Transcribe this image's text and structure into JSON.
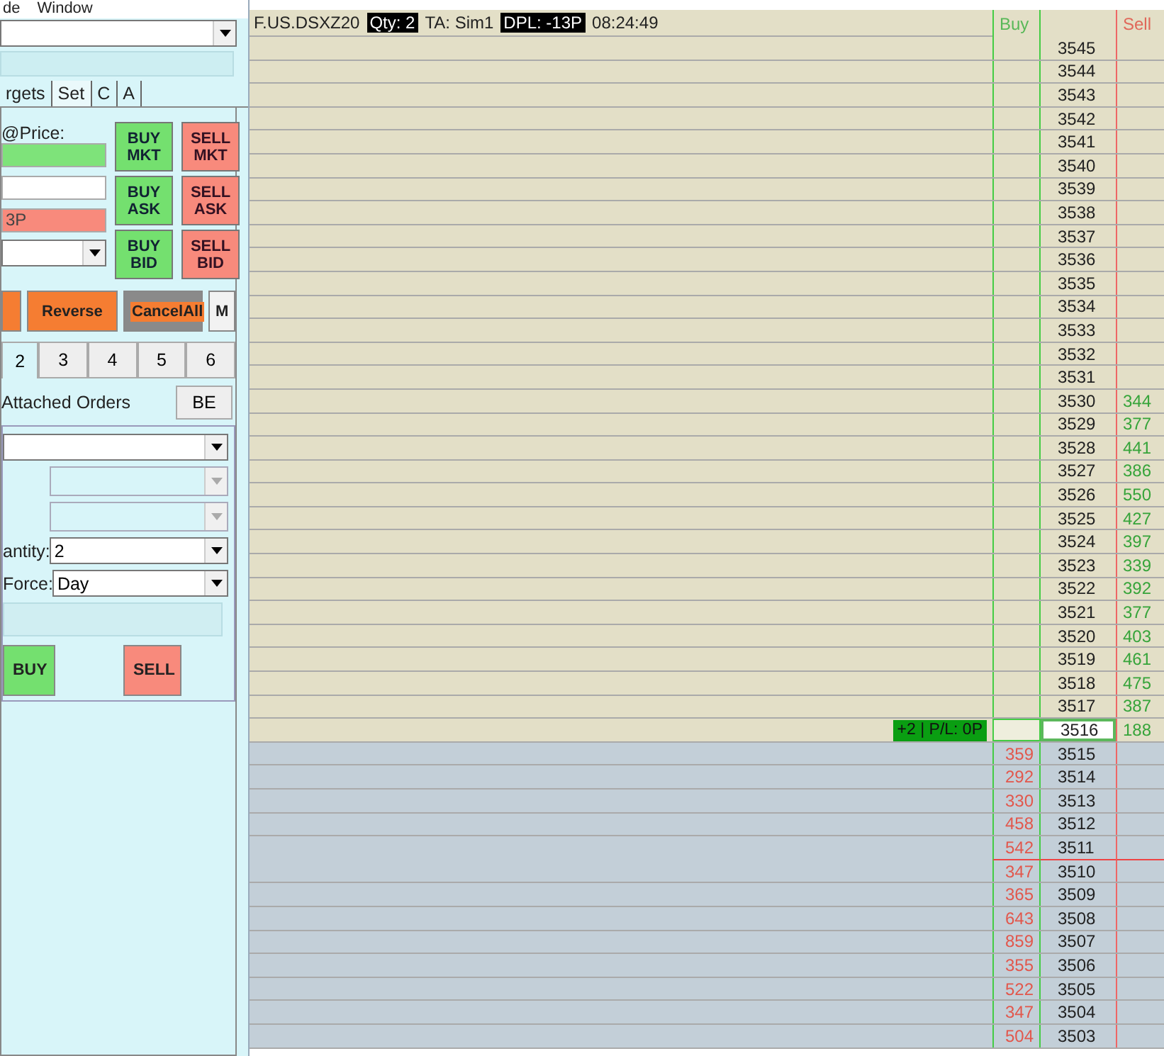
{
  "menu": [
    "de",
    "Window"
  ],
  "order_panel": {
    "tabs": [
      {
        "label": "rgets",
        "selected": false
      },
      {
        "label": "Set",
        "selected": true
      },
      {
        "label": "C",
        "selected": false
      },
      {
        "label": "A",
        "selected": false
      }
    ],
    "price_label": "@Price:",
    "red_field": {
      "value": "3P"
    },
    "order_buttons": [
      {
        "label": "BUY\nMKT",
        "kind": "buy"
      },
      {
        "label": "SELL\nMKT",
        "kind": "sell"
      },
      {
        "label": "BUY\nASK",
        "kind": "buy"
      },
      {
        "label": "SELL\nASK",
        "kind": "sell"
      },
      {
        "label": "BUY\nBID",
        "kind": "buy"
      },
      {
        "label": "SELL\nBID",
        "kind": "sell"
      }
    ],
    "action_buttons": [
      {
        "kind": "orange"
      },
      {
        "label": "Reverse",
        "kind": "orange"
      },
      {
        "label": "CancelAll",
        "kind": "cancel"
      },
      {
        "label": "M",
        "kind": "plain"
      }
    ],
    "number_tabs": [
      {
        "label": "2",
        "selected": true
      },
      {
        "label": "3",
        "selected": false
      },
      {
        "label": "4",
        "selected": false
      },
      {
        "label": "5",
        "selected": false
      },
      {
        "label": "6",
        "selected": false
      }
    ],
    "attached_orders_label": "Attached Orders",
    "be_button": "BE",
    "quantity_label": "antity:",
    "quantity": "2",
    "force_label": "Force:",
    "force": "Day",
    "buy_button": "BUY",
    "sell_button": "SELL"
  },
  "ladder": {
    "symbol": "F.US.DSXZ20",
    "qty": "Qty: 2",
    "account": "TA: Sim1",
    "dpl": "DPL: -13P",
    "time": "08:24:49",
    "buy_header": "Buy",
    "sell_header": "Sell",
    "ask_rows": [
      {
        "price": "3545",
        "selected": false,
        "marked": false
      },
      {
        "price": "3544",
        "selected": false,
        "marked": false
      },
      {
        "price": "3543",
        "selected": false,
        "marked": false
      },
      {
        "price": "3542",
        "selected": false,
        "marked": false
      },
      {
        "price": "3541",
        "selected": false,
        "marked": false
      },
      {
        "price": "3540",
        "selected": false,
        "marked": false
      },
      {
        "price": "3539",
        "selected": false,
        "marked": false
      },
      {
        "price": "3538",
        "selected": false,
        "marked": false
      },
      {
        "price": "3537",
        "selected": false,
        "marked": false
      },
      {
        "price": "3536",
        "selected": false,
        "marked": false
      },
      {
        "price": "3535",
        "selected": false,
        "marked": false
      },
      {
        "price": "3534",
        "selected": false,
        "marked": false
      },
      {
        "price": "3533",
        "selected": false,
        "marked": false
      },
      {
        "price": "3532",
        "selected": false,
        "marked": false
      },
      {
        "price": "3531",
        "selected": false,
        "marked": false
      },
      {
        "price": "3530",
        "sell": "344",
        "selected": false,
        "marked": false
      },
      {
        "price": "3529",
        "sell": "377",
        "selected": false,
        "marked": false
      },
      {
        "price": "3528",
        "sell": "441",
        "selected": false,
        "marked": false
      },
      {
        "price": "3527",
        "sell": "386",
        "selected": false,
        "marked": false
      },
      {
        "price": "3526",
        "sell": "550",
        "selected": false,
        "marked": false
      },
      {
        "price": "3525",
        "sell": "427",
        "selected": false,
        "marked": false
      },
      {
        "price": "3524",
        "sell": "397",
        "selected": false,
        "marked": false
      },
      {
        "price": "3523",
        "sell": "339",
        "selected": false,
        "marked": false
      },
      {
        "price": "3522",
        "sell": "392",
        "selected": false,
        "marked": false
      },
      {
        "price": "3521",
        "sell": "377",
        "selected": false,
        "marked": false
      },
      {
        "price": "3520",
        "sell": "403",
        "selected": false,
        "marked": false
      },
      {
        "price": "3519",
        "sell": "461",
        "selected": false,
        "marked": false
      },
      {
        "price": "3518",
        "sell": "475",
        "selected": false,
        "marked": false
      },
      {
        "price": "3517",
        "sell": "387",
        "selected": false,
        "marked": false
      },
      {
        "price": "3516",
        "sell": "188",
        "selected": true,
        "marked": false,
        "position": "+2 | P/L: 0P"
      }
    ],
    "bid_rows": [
      {
        "price": "3515",
        "buy": "359",
        "selected": false,
        "marked": false
      },
      {
        "price": "3514",
        "buy": "292",
        "selected": false,
        "marked": false
      },
      {
        "price": "3513",
        "buy": "330",
        "selected": false,
        "marked": false
      },
      {
        "price": "3512",
        "buy": "458",
        "selected": false,
        "marked": false
      },
      {
        "price": "3511",
        "buy": "542",
        "selected": false,
        "marked": true
      },
      {
        "price": "3510",
        "buy": "347",
        "selected": false,
        "marked": false
      },
      {
        "price": "3509",
        "buy": "365",
        "selected": false,
        "marked": false
      },
      {
        "price": "3508",
        "buy": "643",
        "selected": false,
        "marked": false
      },
      {
        "price": "3507",
        "buy": "859",
        "selected": false,
        "marked": false
      },
      {
        "price": "3506",
        "buy": "355",
        "selected": false,
        "marked": false
      },
      {
        "price": "3505",
        "buy": "522",
        "selected": false,
        "marked": false
      },
      {
        "price": "3504",
        "buy": "347",
        "selected": false,
        "marked": false
      },
      {
        "price": "3503",
        "buy": "504",
        "selected": false,
        "marked": false
      }
    ]
  }
}
